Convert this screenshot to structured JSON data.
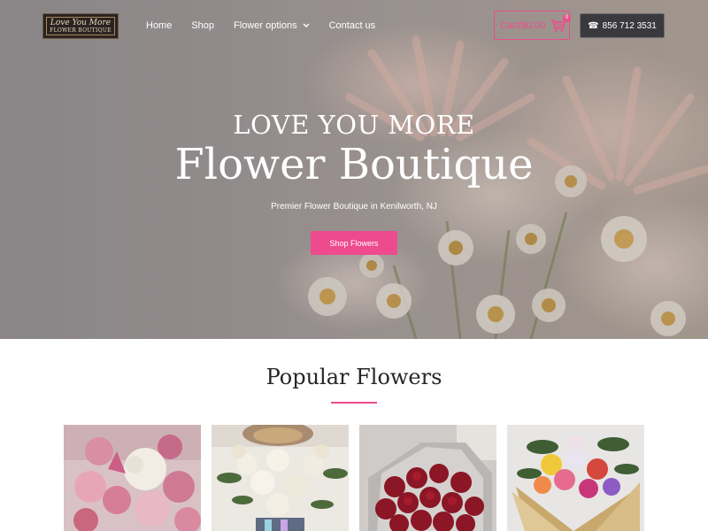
{
  "header": {
    "logo": {
      "line1": "Love You More",
      "line2": "FLOWER BOUTIQUE"
    },
    "nav": [
      {
        "label": "Home"
      },
      {
        "label": "Shop"
      },
      {
        "label": "Flower options",
        "has_dropdown": true,
        "icon": "chevron-down-icon"
      },
      {
        "label": "Contact us"
      }
    ],
    "cart": {
      "label": "Cart/$0.00",
      "count": "0",
      "icon": "shopping-cart-icon"
    },
    "phone": {
      "label": "856 712 3531",
      "icon": "phone-icon"
    }
  },
  "hero": {
    "eyebrow": "LOVE YOU MORE",
    "title": "Flower Boutique",
    "subtitle": "Premier Flower Boutique in Kenilworth, NJ",
    "button_label": "Shop Flowers"
  },
  "popular": {
    "title": "Popular Flowers",
    "products": [
      {
        "name": "pink-lilies-roses-bouquet"
      },
      {
        "name": "white-roses-arrangement"
      },
      {
        "name": "red-roses-bouquet"
      },
      {
        "name": "mixed-wrapped-bouquet"
      }
    ]
  },
  "colors": {
    "accent": "#ed4b8e",
    "phone_bg": "#3a3a3e",
    "text_dark": "#262626"
  }
}
